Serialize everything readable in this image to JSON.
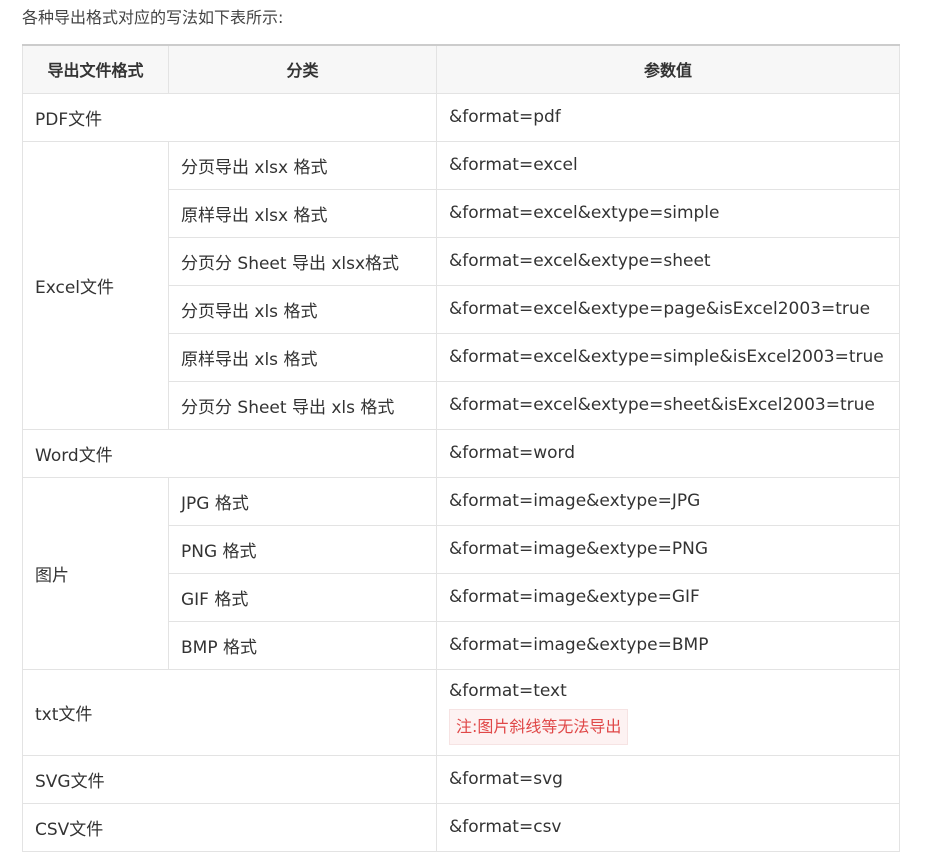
{
  "intro": "各种导出格式对应的写法如下表所示:",
  "headers": [
    "导出文件格式",
    "分类",
    "参数值"
  ],
  "rows": {
    "pdf": {
      "format": "PDF文件",
      "param": "&format=pdf"
    },
    "excel": {
      "format": "Excel文件",
      "items": [
        {
          "category": "分页导出 xlsx 格式",
          "param": "&format=excel"
        },
        {
          "category": "原样导出 xlsx 格式",
          "param": "&format=excel&extype=simple"
        },
        {
          "category": "分页分 Sheet 导出 xlsx格式",
          "param": "&format=excel&extype=sheet"
        },
        {
          "category": "分页导出 xls 格式",
          "param": "&format=excel&extype=page&isExcel2003=true"
        },
        {
          "category": "原样导出 xls 格式",
          "param": "&format=excel&extype=simple&isExcel2003=true"
        },
        {
          "category": "分页分 Sheet 导出 xls 格式",
          "param": "&format=excel&extype=sheet&isExcel2003=true"
        }
      ]
    },
    "word": {
      "format": "Word文件",
      "param": "&format=word"
    },
    "image": {
      "format": "图片",
      "items": [
        {
          "category": "JPG 格式",
          "param": "&format=image&extype=JPG"
        },
        {
          "category": "PNG 格式",
          "param": "&format=image&extype=PNG"
        },
        {
          "category": "GIF 格式",
          "param": "&format=image&extype=GIF"
        },
        {
          "category": "BMP 格式",
          "param": "&format=image&extype=BMP"
        }
      ]
    },
    "txt": {
      "format": "txt文件",
      "param": "&format=text",
      "note": "注:图片斜线等无法导出"
    },
    "svg": {
      "format": "SVG文件",
      "param": "&format=svg"
    },
    "csv": {
      "format": "CSV文件",
      "param": "&format=csv"
    }
  },
  "colors": {
    "note_text": "#e04848",
    "note_bg": "#fdf2f2",
    "header_bg": "#f7f7f7",
    "border": "#e3e3e3"
  }
}
